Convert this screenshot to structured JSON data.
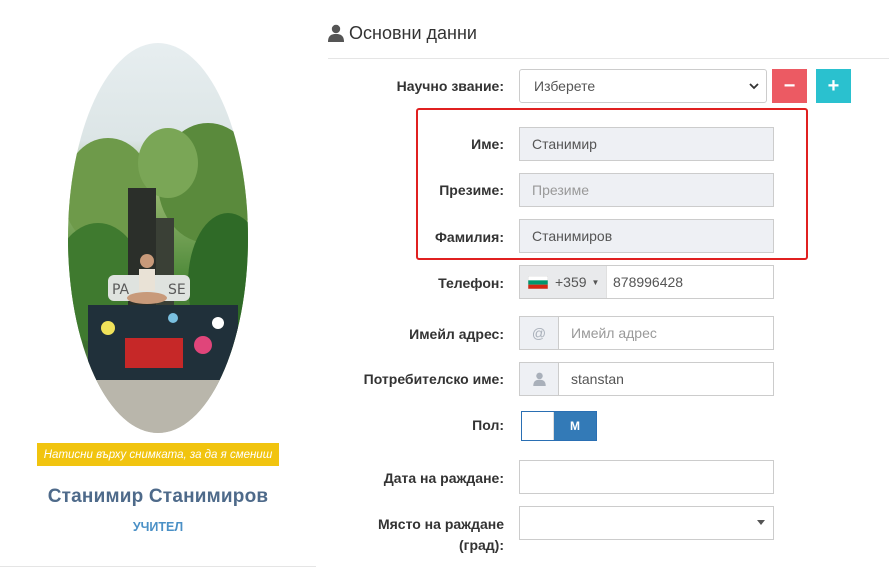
{
  "profile": {
    "photo_hint": "Натисни върху снимката, за да я смениш",
    "name": "Станимир Станимиров",
    "role": "УЧИТЕЛ"
  },
  "section": {
    "title": "Основни данни",
    "icon": "user-icon"
  },
  "form": {
    "title_label": "Научно звание:",
    "title_select_value": "Изберете",
    "minus_label": "−",
    "plus_label": "+",
    "first_name_label": "Име:",
    "first_name_value": "Станимир",
    "middle_name_label": "Презиме:",
    "middle_name_placeholder": "Презиме",
    "last_name_label": "Фамилия:",
    "last_name_value": "Станимиров",
    "phone_label": "Телефон:",
    "phone_prefix": "+359",
    "phone_flag": "bulgaria-flag-icon",
    "phone_value": "878996428",
    "email_label": "Имейл адрес:",
    "email_addon": "@",
    "email_placeholder": "Имейл адрес",
    "username_label": "Потребителско име:",
    "username_value": "stanstan",
    "gender_label": "Пол:",
    "gender_value": "М",
    "birthdate_label": "Дата на раждане:",
    "birthplace_label_line1": "Място на раждане",
    "birthplace_label_line2": "(град):"
  },
  "colors": {
    "highlight": "#e02020",
    "minus_button": "#ec5a63",
    "plus_button": "#2ac1cf",
    "hint_bg": "#f1c40f",
    "toggle_on": "#337ab7"
  }
}
